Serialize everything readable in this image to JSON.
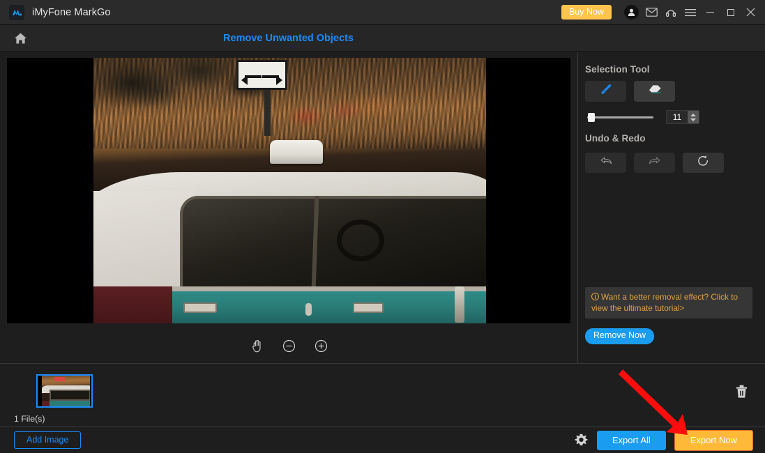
{
  "app": {
    "title": "iMyFone MarkGo",
    "logo_icon": "markgo-logo-icon"
  },
  "titlebar": {
    "buy_now_label": "Buy Now",
    "account_icon": "user-avatar-icon",
    "mail_icon": "mail-icon",
    "support_icon": "headset-support-icon",
    "menu_icon": "hamburger-menu-icon",
    "minimize_icon": "minimize-icon",
    "maximize_icon": "maximize-icon",
    "close_icon": "close-icon"
  },
  "subheader": {
    "home_icon": "home-icon",
    "page_title": "Remove Unwanted Objects"
  },
  "canvas": {
    "pan_icon": "hand-pan-icon",
    "zoom_out_icon": "zoom-out-icon",
    "zoom_in_icon": "zoom-in-icon",
    "image_alt": "vintage teal and white taxi car with two-way arrow road sign"
  },
  "right_panel": {
    "selection_tool_title": "Selection Tool",
    "brush_icon": "brush-icon",
    "eraser_icon": "eraser-icon",
    "brush_size_value": "11",
    "slider_percent": 6,
    "undo_redo_title": "Undo & Redo",
    "undo_icon": "undo-arrow-icon",
    "redo_icon": "redo-arrow-icon",
    "reset_icon": "reset-refresh-icon",
    "tip_text": "Want a better removal effect? Click to view the ultimate tutorial>",
    "tip_warning_icon": "warning-circle-icon",
    "remove_now_label": "Remove Now"
  },
  "filmstrip": {
    "file_count": "1 File(s)",
    "delete_icon": "trash-icon",
    "thumbnail_name": "image-thumbnail"
  },
  "bottombar": {
    "add_image_label": "Add Image",
    "settings_icon": "gear-icon",
    "export_all_label": "Export All",
    "export_now_label": "Export Now"
  },
  "annotation": {
    "arrow_icon": "red-pointer-arrow",
    "arrow_color": "#ff0d0d",
    "points_to": "export-now-button"
  },
  "colors": {
    "accent_blue": "#1a9cf0",
    "accent_orange": "#ffb938",
    "buy_now_yellow": "#ffc44d",
    "title_blue": "#1a8cff",
    "tip_orange": "#e0a33c",
    "panel_bg": "#1e1e1e",
    "titlebar_bg": "#2b2b2b",
    "subheader_bg": "#262626"
  }
}
